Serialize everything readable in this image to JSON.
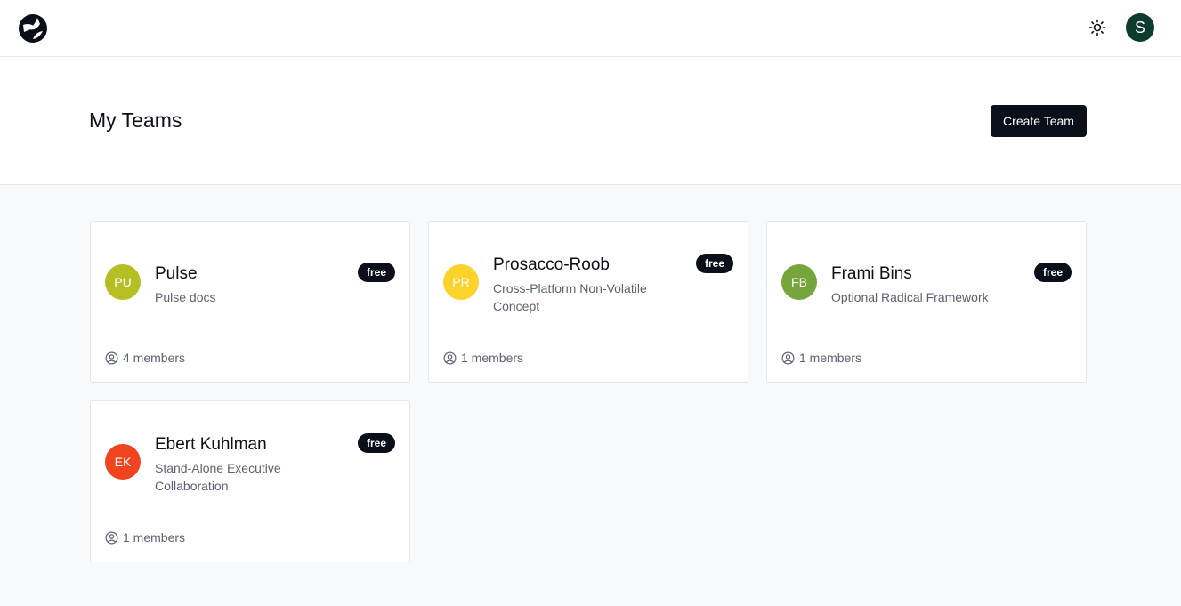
{
  "colors": {
    "dark": "#0b0f19",
    "user_avatar": "#0d3b2e"
  },
  "topbar": {
    "logo_icon": "swirl-logo-icon",
    "theme_icon": "sun-icon",
    "user_initial": "S"
  },
  "header": {
    "title": "My Teams",
    "create_button": "Create Team"
  },
  "teams": [
    {
      "initials": "PU",
      "name": "Pulse",
      "description": "Pulse docs",
      "plan": "free",
      "members": "4 members",
      "color": "#b5be22"
    },
    {
      "initials": "PR",
      "name": "Prosacco-Roob",
      "description": "Cross-Platform Non-Volatile Concept",
      "plan": "free",
      "members": "1 members",
      "color": "#fcd22b"
    },
    {
      "initials": "FB",
      "name": "Frami Bins",
      "description": "Optional Radical Framework",
      "plan": "free",
      "members": "1 members",
      "color": "#76a63b"
    },
    {
      "initials": "EK",
      "name": "Ebert Kuhlman",
      "description": "Stand-Alone Executive Collaboration",
      "plan": "free",
      "members": "1 members",
      "color": "#f0441f"
    }
  ]
}
